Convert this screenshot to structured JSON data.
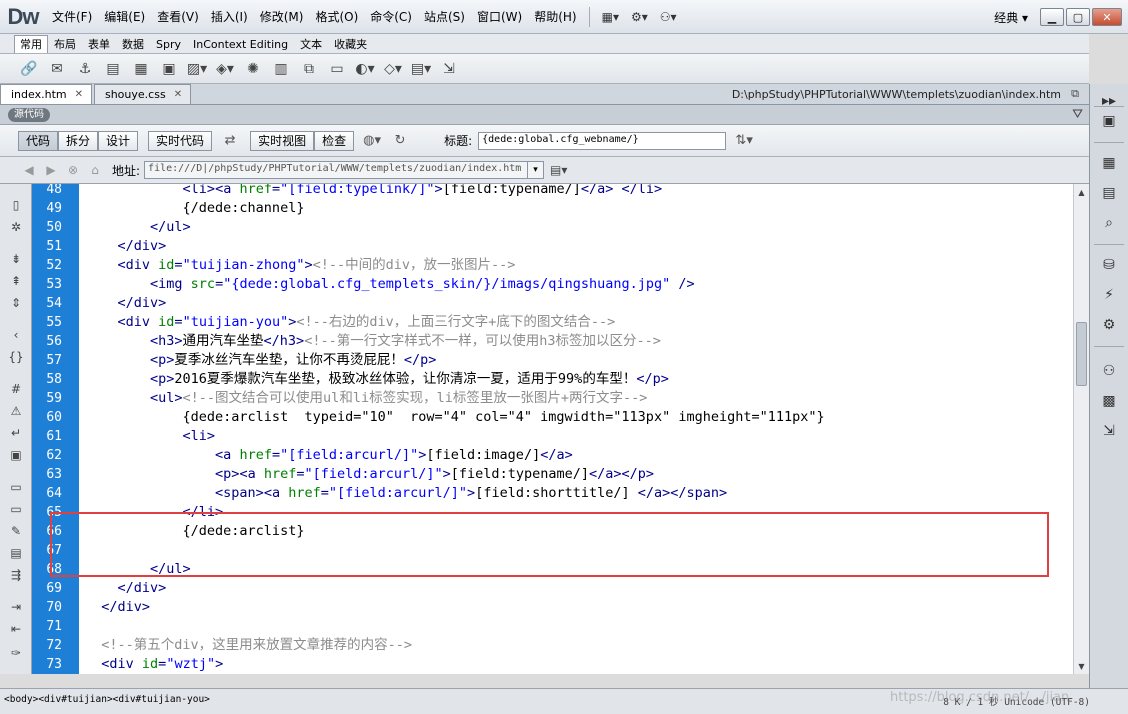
{
  "app": {
    "logo": "Dw",
    "workspace": "经典"
  },
  "menus": [
    "文件(F)",
    "编辑(E)",
    "查看(V)",
    "插入(I)",
    "修改(M)",
    "格式(O)",
    "命令(C)",
    "站点(S)",
    "窗口(W)",
    "帮助(H)"
  ],
  "insert_tabs": [
    "常用",
    "布局",
    "表单",
    "数据",
    "Spry",
    "InContext Editing",
    "文本",
    "收藏夹"
  ],
  "doc_tabs": [
    {
      "label": "index.htm",
      "active": true
    },
    {
      "label": "shouye.css",
      "active": false
    }
  ],
  "doc_path": "D:\\phpStudy\\PHPTutorial\\WWW\\templets\\zuodian\\index.htm",
  "source_label": "源代码",
  "view_buttons": [
    "代码",
    "拆分",
    "设计",
    "实时代码",
    "实时视图",
    "检查"
  ],
  "title_label": "标题:",
  "title_value": "{dede:global.cfg_webname/}",
  "address_label": "地址:",
  "address_value": "file:///D|/phpStudy/PHPTutorial/WWW/templets/zuodian/index.htm",
  "icons": {
    "close": "close-icon",
    "minimize": "minimize-icon",
    "maximize": "maximize-icon",
    "filter": "filter-icon"
  },
  "colors": {
    "gutter": "#1e7fd6",
    "tag": "#00008b",
    "attr": "#008000",
    "value": "#0000ff",
    "comment": "#8c8c8c",
    "highlight_box": "#e04040"
  },
  "code_lines": [
    {
      "n": "48",
      "segs": [
        [
          "txt",
          "            "
        ],
        [
          "tag",
          "<li>"
        ],
        [
          "tag",
          "<a "
        ],
        [
          "attr",
          "href"
        ],
        [
          "tag",
          "="
        ],
        [
          "val",
          "\"[field:typelink/]\""
        ],
        [
          "tag",
          ">"
        ],
        [
          "txt",
          "[field:typename/]"
        ],
        [
          "tag",
          "</a>"
        ],
        [
          "txt",
          " "
        ],
        [
          "tag",
          "</li>"
        ]
      ]
    },
    {
      "n": "49",
      "segs": [
        [
          "txt",
          "            {/dede:channel}"
        ]
      ]
    },
    {
      "n": "50",
      "segs": [
        [
          "txt",
          "        "
        ],
        [
          "tag",
          "</ul>"
        ]
      ]
    },
    {
      "n": "51",
      "segs": [
        [
          "txt",
          "    "
        ],
        [
          "tag",
          "</div>"
        ]
      ]
    },
    {
      "n": "52",
      "segs": [
        [
          "txt",
          "    "
        ],
        [
          "tag",
          "<div "
        ],
        [
          "attr",
          "id"
        ],
        [
          "tag",
          "="
        ],
        [
          "val",
          "\"tuijian-zhong\""
        ],
        [
          "tag",
          ">"
        ],
        [
          "cmt",
          "<!--中间的div，放一张图片-->"
        ]
      ]
    },
    {
      "n": "53",
      "segs": [
        [
          "txt",
          "        "
        ],
        [
          "tag",
          "<img "
        ],
        [
          "attr",
          "src"
        ],
        [
          "tag",
          "="
        ],
        [
          "val",
          "\"{dede:global.cfg_templets_skin/}/imags/qingshuang.jpg\""
        ],
        [
          "txt",
          " "
        ],
        [
          "tag",
          "/>"
        ]
      ]
    },
    {
      "n": "54",
      "segs": [
        [
          "txt",
          "    "
        ],
        [
          "tag",
          "</div>"
        ]
      ]
    },
    {
      "n": "55",
      "segs": [
        [
          "txt",
          "    "
        ],
        [
          "tag",
          "<div "
        ],
        [
          "attr",
          "id"
        ],
        [
          "tag",
          "="
        ],
        [
          "val",
          "\"tuijian-you\""
        ],
        [
          "tag",
          ">"
        ],
        [
          "cmt",
          "<!--右边的div，上面三行文字+底下的图文结合-->"
        ]
      ]
    },
    {
      "n": "56",
      "segs": [
        [
          "txt",
          "        "
        ],
        [
          "tag",
          "<h3>"
        ],
        [
          "txt",
          "通用汽车坐垫"
        ],
        [
          "tag",
          "</h3>"
        ],
        [
          "cmt",
          "<!--第一行文字样式不一样，可以使用h3标签加以区分-->"
        ]
      ]
    },
    {
      "n": "57",
      "segs": [
        [
          "txt",
          "        "
        ],
        [
          "tag",
          "<p>"
        ],
        [
          "txt",
          "夏季冰丝汽车坐垫，让你不再烫屁屁！"
        ],
        [
          "tag",
          "</p>"
        ]
      ]
    },
    {
      "n": "58",
      "segs": [
        [
          "txt",
          "        "
        ],
        [
          "tag",
          "<p>"
        ],
        [
          "txt",
          "2016夏季爆款汽车坐垫，极致冰丝体验，让你清凉一夏，适用于99%的车型！"
        ],
        [
          "tag",
          "</p>"
        ]
      ]
    },
    {
      "n": "59",
      "segs": [
        [
          "txt",
          "        "
        ],
        [
          "tag",
          "<ul>"
        ],
        [
          "cmt",
          "<!--图文结合可以使用ul和li标签实现，li标签里放一张图片+两行文字-->"
        ]
      ]
    },
    {
      "n": "60",
      "segs": [
        [
          "txt",
          "            {dede:arclist  typeid=\"10\"  row=\"4\" col=\"4\" imgwidth=\"113px\" imgheight=\"111px\"}"
        ]
      ]
    },
    {
      "n": "61",
      "segs": [
        [
          "txt",
          "            "
        ],
        [
          "tag",
          "<li>"
        ]
      ]
    },
    {
      "n": "62",
      "segs": [
        [
          "txt",
          "                "
        ],
        [
          "tag",
          "<a "
        ],
        [
          "attr",
          "href"
        ],
        [
          "tag",
          "="
        ],
        [
          "val",
          "\"[field:arcurl/]\""
        ],
        [
          "tag",
          ">"
        ],
        [
          "txt",
          "[field:image/]"
        ],
        [
          "tag",
          "</a>"
        ]
      ]
    },
    {
      "n": "63",
      "segs": [
        [
          "txt",
          "                "
        ],
        [
          "tag",
          "<p>"
        ],
        [
          "tag",
          "<a "
        ],
        [
          "attr",
          "href"
        ],
        [
          "tag",
          "="
        ],
        [
          "val",
          "\"[field:arcurl/]\""
        ],
        [
          "tag",
          ">"
        ],
        [
          "txt",
          "[field:typename/]"
        ],
        [
          "tag",
          "</a>"
        ],
        [
          "tag",
          "</p>"
        ]
      ]
    },
    {
      "n": "64",
      "segs": [
        [
          "txt",
          "                "
        ],
        [
          "tag",
          "<span>"
        ],
        [
          "tag",
          "<a "
        ],
        [
          "attr",
          "href"
        ],
        [
          "tag",
          "="
        ],
        [
          "val",
          "\"[field:arcurl/]\""
        ],
        [
          "tag",
          ">"
        ],
        [
          "txt",
          "[field:shorttitle/] "
        ],
        [
          "tag",
          "</a>"
        ],
        [
          "tag",
          "</span>"
        ]
      ]
    },
    {
      "n": "65",
      "segs": [
        [
          "txt",
          "            "
        ],
        [
          "tag",
          "</li>"
        ]
      ]
    },
    {
      "n": "66",
      "segs": [
        [
          "txt",
          "            {/dede:arclist}"
        ]
      ]
    },
    {
      "n": "67",
      "segs": [
        [
          "txt",
          ""
        ]
      ]
    },
    {
      "n": "68",
      "segs": [
        [
          "txt",
          "        "
        ],
        [
          "tag",
          "</ul>"
        ]
      ]
    },
    {
      "n": "69",
      "segs": [
        [
          "txt",
          "    "
        ],
        [
          "tag",
          "</div>"
        ]
      ]
    },
    {
      "n": "70",
      "segs": [
        [
          "txt",
          "  "
        ],
        [
          "tag",
          "</div>"
        ]
      ]
    },
    {
      "n": "71",
      "segs": [
        [
          "txt",
          ""
        ]
      ]
    },
    {
      "n": "72",
      "segs": [
        [
          "txt",
          "  "
        ],
        [
          "cmt",
          "<!--第五个div，这里用来放置文章推荐的内容-->"
        ]
      ]
    },
    {
      "n": "73",
      "segs": [
        [
          "txt",
          "  "
        ],
        [
          "tag",
          "<div "
        ],
        [
          "attr",
          "id"
        ],
        [
          "tag",
          "="
        ],
        [
          "val",
          "\"wztj\""
        ],
        [
          "tag",
          ">"
        ]
      ]
    }
  ],
  "status": {
    "tag_path": "<body><div#tuijian><div#tuijian-you>",
    "info": "8 K / 1 秒  Unicode (UTF-8)"
  },
  "watermark": "https://blog.csdn.net/.../jian"
}
